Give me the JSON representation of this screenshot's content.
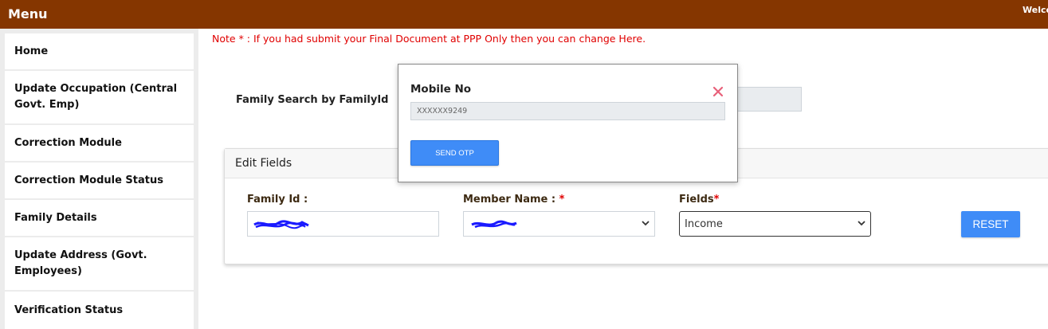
{
  "header": {
    "menu_title": "Menu",
    "welcome_text": "Welcome"
  },
  "sidebar": {
    "items": [
      {
        "label": "Home"
      },
      {
        "label": "Update Occupation (Central Govt. Emp)"
      },
      {
        "label": "Correction Module"
      },
      {
        "label": "Correction Module Status"
      },
      {
        "label": "Family Details"
      },
      {
        "label": "Update Address (Govt. Employees)"
      },
      {
        "label": "Verification Status"
      }
    ]
  },
  "main": {
    "note": "Note * : If you had submit your Final Document at PPP Only then you can change Here.",
    "search_label": "Family Search by FamilyId",
    "edit_fields": {
      "title": "Edit Fields",
      "family_id_label": "Family Id :",
      "member_name_label": "Member Name : ",
      "required_mark": "*",
      "fields_label": "Fields",
      "fields_value": "Income",
      "reset_label": "RESET"
    }
  },
  "modal": {
    "mobile_label": "Mobile No",
    "mobile_value": "XXXXXX9249",
    "send_otp_label": "SEND OTP"
  },
  "colors": {
    "header_bg": "#853600",
    "accent_blue": "#3f8cf7",
    "note_red": "#e00000",
    "scribble_blue": "#1a1aff"
  }
}
